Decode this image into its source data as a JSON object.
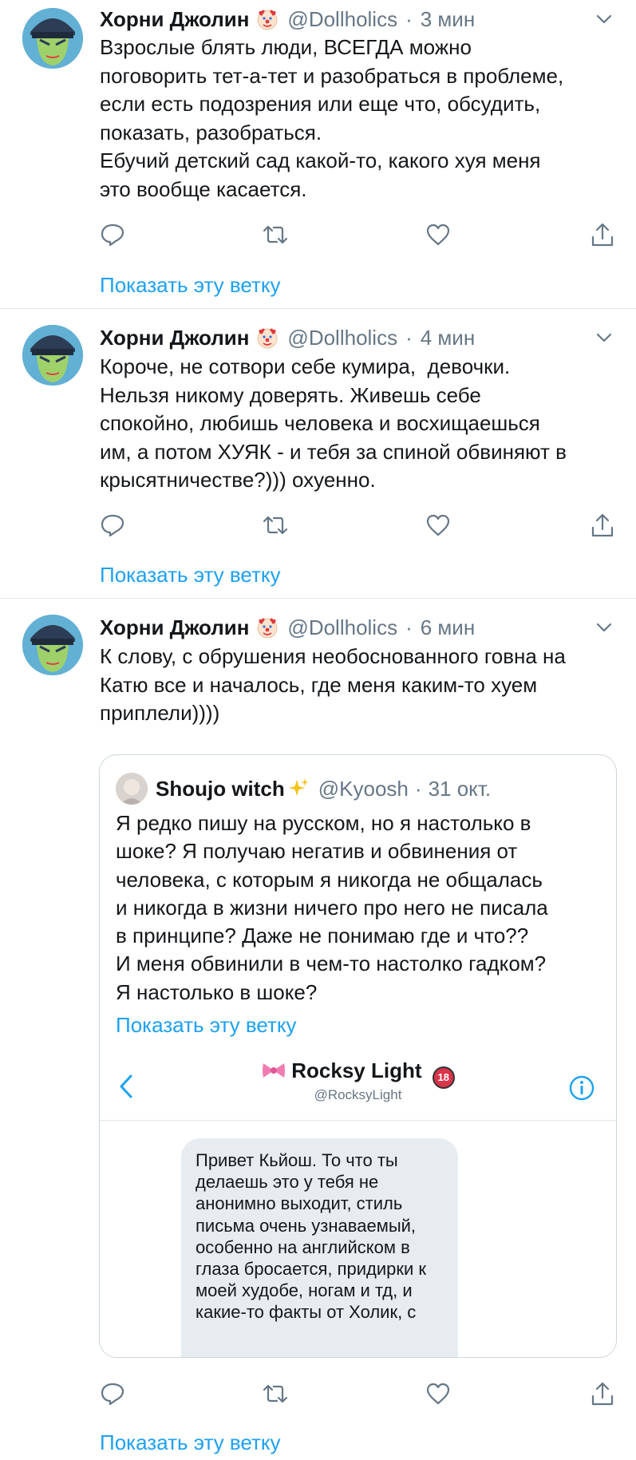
{
  "tweets": [
    {
      "author_name": "Хорни Джолин",
      "handle": "@Dollholics",
      "dot": "·",
      "time": "3 мин",
      "text": "Взрослые блять люди, ВСЕГДА можно\nпоговорить тет-а-тет и разобраться в проблеме,\nесли есть подозрения или еще что, обсудить,\nпоказать, разобраться.\nЕбучий детский сад какой-то, какого хуя меня\nэто вообще касается.",
      "show_thread": "Показать эту ветку"
    },
    {
      "author_name": "Хорни Джолин",
      "handle": "@Dollholics",
      "dot": "·",
      "time": "4 мин",
      "text": "Короче, не сотвори себе кумира,  девочки.\nНельзя никому доверять. Живешь себе\nспокойно, любишь человека и восхищаешься\nим, а потом ХУЯК - и тебя за спиной обвиняют в\nкрысятничестве?))) охуенно.",
      "show_thread": "Показать эту ветку"
    },
    {
      "author_name": "Хорни Джолин",
      "handle": "@Dollholics",
      "dot": "·",
      "time": "6 мин",
      "text": "К слову, с обрушения необоснованного говна на\nКатю все и началось, где меня каким-то хуем\nприплели))))",
      "show_thread": "Показать эту ветку",
      "quote": {
        "author_name": "Shoujo witch",
        "handle": "@Kyoosh",
        "dot": "·",
        "time": "31 окт.",
        "text": "Я редко пишу на русском, но я настолько в\nшоке? Я получаю негатив и обвинения от\nчеловека, с которым я никогда не общалась\nи никогда в жизни ничего про него не писала\nв принципе? Даже не понимаю где и что??\nИ меня обвинили в чем-то настолко гадком?\nЯ настолько в шоке?",
        "show_thread": "Показать эту ветку",
        "screenshot": {
          "title": "Rocksy Light",
          "subtitle": "@RocksyLight",
          "badge": "18",
          "message": "Привет Кьйош. То что ты\nделаешь это у тебя не\nанонимно выходит, стиль\nписьма очень узнаваемый,\nособенно на английском в\nглаза бросается, придирки к\nмоей худобе, ногам и тд, и\nкакие-то факты от Холик, с"
        }
      }
    }
  ],
  "icons": {
    "reply": "reply-icon",
    "retweet": "retweet-icon",
    "like": "like-icon",
    "share": "share-icon",
    "caret": "chevron-down-icon",
    "clown": "clown-emoji-icon",
    "sparkles": "sparkles-emoji-icon",
    "bow": "ribbon-emoji-icon"
  },
  "colors": {
    "link": "#1da1f2",
    "secondary_text": "#657786",
    "divider": "#e1e8ed"
  }
}
